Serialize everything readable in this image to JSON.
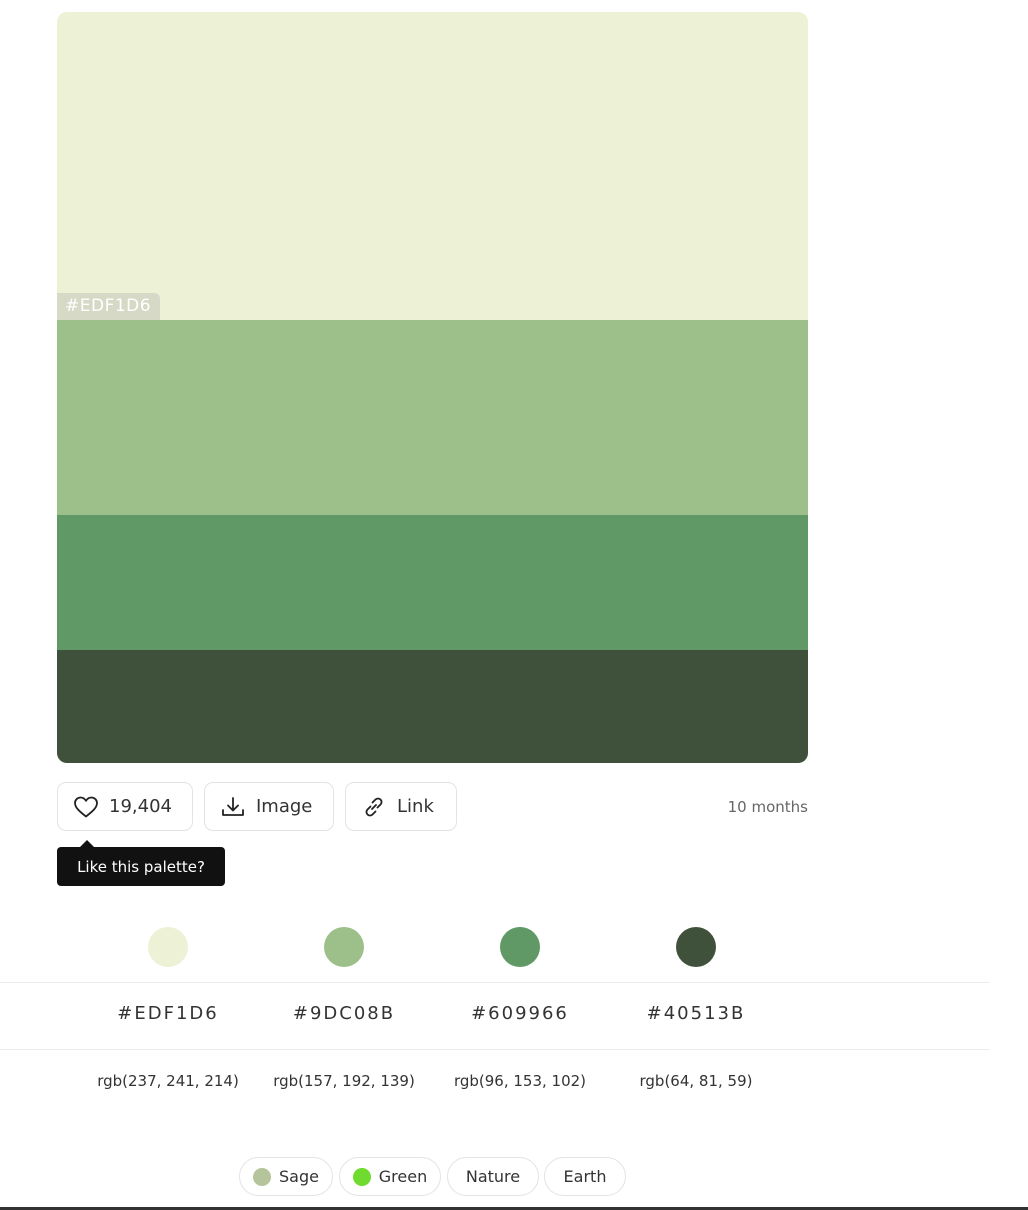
{
  "palette": {
    "colors": [
      {
        "hex": "#EDF1D6",
        "rgb": "rgb(237, 241, 214)"
      },
      {
        "hex": "#9DC08B",
        "rgb": "rgb(157, 192, 139)"
      },
      {
        "hex": "#609966",
        "rgb": "rgb(96, 153, 102)"
      },
      {
        "hex": "#40513B",
        "rgb": "rgb(64, 81, 59)"
      }
    ],
    "hover_label": "#EDF1D6"
  },
  "actions": {
    "like_count": "19,404",
    "image_label": "Image",
    "link_label": "Link",
    "time_ago": "10 months",
    "tooltip": "Like this palette?"
  },
  "tags": [
    {
      "label": "Sage",
      "dot_color": "#B5C49A"
    },
    {
      "label": "Green",
      "dot_color": "#6EDB2E"
    },
    {
      "label": "Nature"
    },
    {
      "label": "Earth"
    }
  ],
  "icons": {
    "like": "heart-icon",
    "image": "download-icon",
    "link": "link-icon"
  }
}
